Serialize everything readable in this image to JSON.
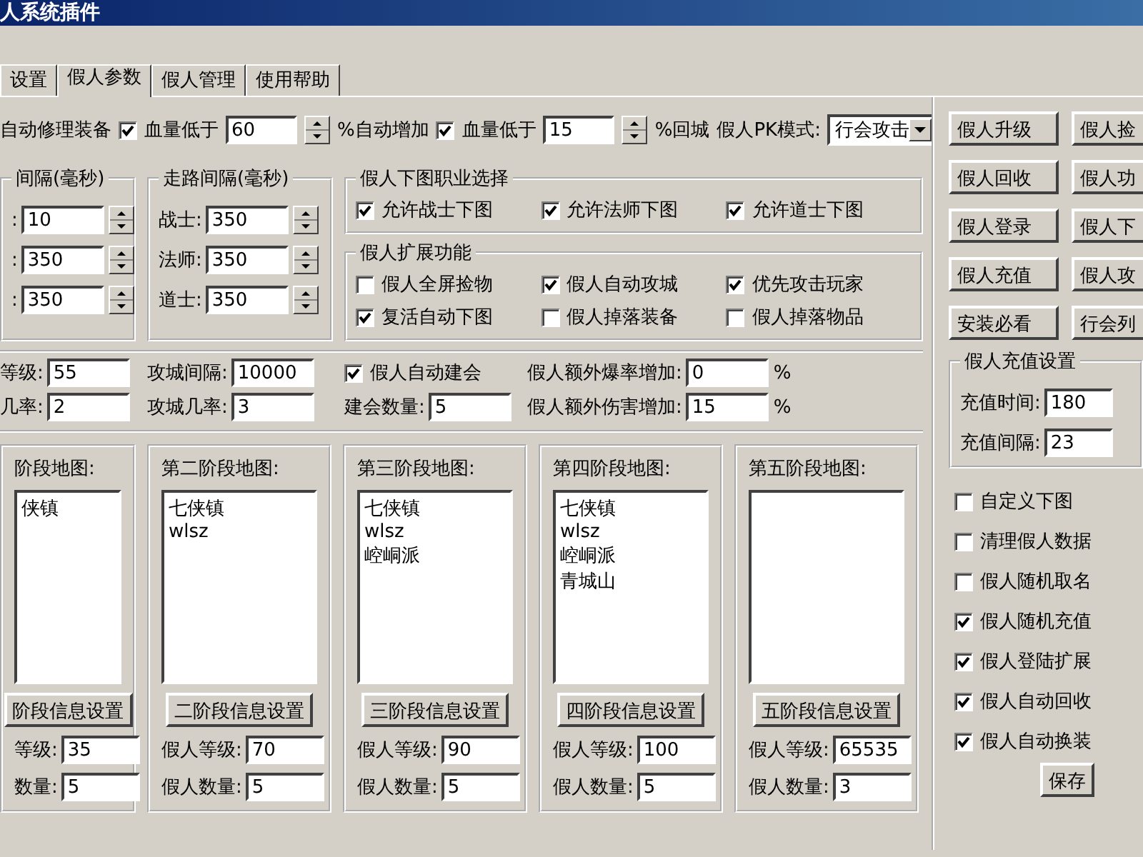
{
  "window": {
    "title": "人系统插件"
  },
  "tabs": [
    {
      "label": "设置",
      "selected": false
    },
    {
      "label": "假人参数",
      "selected": true
    },
    {
      "label": "假人管理",
      "selected": false
    },
    {
      "label": "使用帮助",
      "selected": false
    }
  ],
  "top_row": [
    {
      "kind": "label",
      "text": "自动修理装备"
    },
    {
      "kind": "checkbox",
      "label": "血量低于",
      "checked": true
    },
    {
      "kind": "spin",
      "value": "60"
    },
    {
      "kind": "label",
      "text": "%自动增加"
    },
    {
      "kind": "checkbox",
      "label": "血量低于",
      "checked": true
    },
    {
      "kind": "spin",
      "value": "15"
    },
    {
      "kind": "label",
      "text": "%回城"
    },
    {
      "kind": "label",
      "text": "假人PK模式:"
    },
    {
      "kind": "combo",
      "value": "行会攻击"
    }
  ],
  "attack_interval": {
    "title": "间隔(毫秒)",
    "rows": [
      {
        "label": ":",
        "value": "10"
      },
      {
        "label": ":",
        "value": "350"
      },
      {
        "label": ":",
        "value": "350"
      }
    ]
  },
  "walk_interval": {
    "title": "走路间隔(毫秒)",
    "rows": [
      {
        "label": "战士:",
        "value": "350"
      },
      {
        "label": "法师:",
        "value": "350"
      },
      {
        "label": "道士:",
        "value": "350"
      }
    ]
  },
  "job_select": {
    "title": "假人下图职业选择",
    "options": [
      {
        "label": "允许战士下图",
        "checked": true
      },
      {
        "label": "允许法师下图",
        "checked": true
      },
      {
        "label": "允许道士下图",
        "checked": true
      }
    ]
  },
  "extensions": {
    "title": "假人扩展功能",
    "options": [
      {
        "label": "假人全屏捡物",
        "checked": false
      },
      {
        "label": "假人自动攻城",
        "checked": true
      },
      {
        "label": "优先攻击玩家",
        "checked": true
      },
      {
        "label": "复活自动下图",
        "checked": true
      },
      {
        "label": "假人掉落装备",
        "checked": false
      },
      {
        "label": "假人掉落物品",
        "checked": false
      }
    ]
  },
  "params": [
    {
      "items": [
        {
          "kind": "field",
          "label": "等级:",
          "value": "55"
        },
        {
          "kind": "field",
          "label": "几率:",
          "value": "2"
        }
      ]
    },
    {
      "items": [
        {
          "kind": "field",
          "label": "攻城间隔:",
          "value": "10000"
        },
        {
          "kind": "field",
          "label": "攻城几率:",
          "value": "3"
        }
      ]
    },
    {
      "items": [
        {
          "kind": "checkbox",
          "label": "假人自动建会",
          "checked": true
        },
        {
          "kind": "field",
          "label": "建会数量:",
          "value": "5"
        }
      ]
    },
    {
      "items": [
        {
          "kind": "field",
          "label": "假人额外爆率增加:",
          "value": "0",
          "unit": "%"
        },
        {
          "kind": "field",
          "label": "假人额外伤害增加:",
          "value": "15",
          "unit": "%"
        }
      ]
    }
  ],
  "stages": [
    {
      "title": "阶段地图:",
      "maps": [
        "侠镇"
      ],
      "button": "阶段信息设置",
      "fields": [
        {
          "label": "等级:",
          "value": "35"
        },
        {
          "label": "数量:",
          "value": "5"
        }
      ]
    },
    {
      "title": "第二阶段地图:",
      "maps": [
        "七侠镇",
        "wlsz"
      ],
      "button": "二阶段信息设置",
      "fields": [
        {
          "label": "假人等级:",
          "value": "70"
        },
        {
          "label": "假人数量:",
          "value": "5"
        }
      ]
    },
    {
      "title": "第三阶段地图:",
      "maps": [
        "七侠镇",
        "wlsz",
        "崆峒派"
      ],
      "button": "三阶段信息设置",
      "fields": [
        {
          "label": "假人等级:",
          "value": "90"
        },
        {
          "label": "假人数量:",
          "value": "5"
        }
      ]
    },
    {
      "title": "第四阶段地图:",
      "maps": [
        "七侠镇",
        "wlsz",
        "崆峒派",
        "青城山"
      ],
      "button": "四阶段信息设置",
      "fields": [
        {
          "label": "假人等级:",
          "value": "100"
        },
        {
          "label": "假人数量:",
          "value": "5"
        }
      ]
    },
    {
      "title": "第五阶段地图:",
      "button": "五阶段信息设置",
      "fields": [
        {
          "label": "假人等级:",
          "value": "65535"
        },
        {
          "label": "假人数量:",
          "value": "3"
        }
      ]
    }
  ],
  "side_buttons": [
    "假人升级",
    "假人捡",
    "假人回收",
    "假人功",
    "假人登录",
    "假人下",
    "假人充值",
    "假人攻",
    "安装必看",
    "行会列"
  ],
  "recharge": {
    "title": "假人充值设置",
    "fields": [
      {
        "label": "充值时间:",
        "value": "180"
      },
      {
        "label": "充值间隔:",
        "value": "23"
      }
    ]
  },
  "options": [
    {
      "label": "自定义下图",
      "checked": false
    },
    {
      "label": "清理假人数据",
      "checked": false
    },
    {
      "label": "假人随机取名",
      "checked": false
    },
    {
      "label": "假人随机充值",
      "checked": true
    },
    {
      "label": "假人登陆扩展",
      "checked": true
    },
    {
      "label": "假人自动回收",
      "checked": true
    },
    {
      "label": "假人自动换装",
      "checked": true
    }
  ],
  "save_button": "保存"
}
